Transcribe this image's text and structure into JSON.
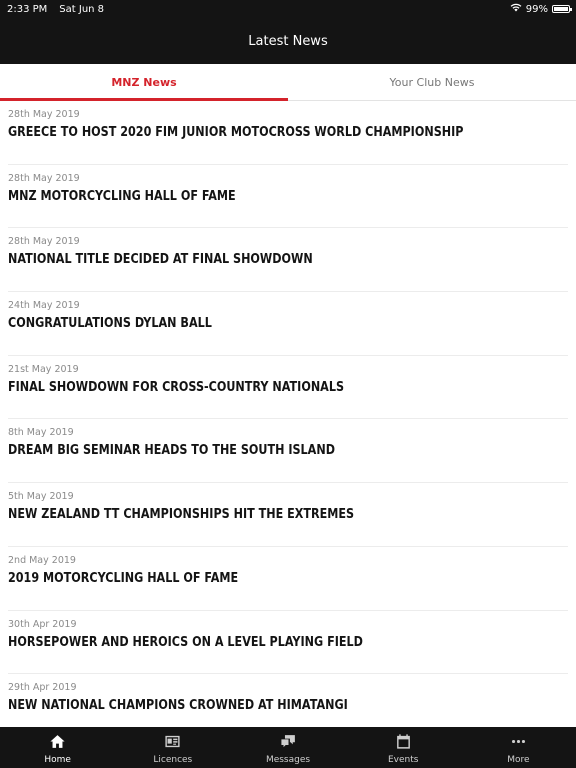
{
  "status_bar": {
    "time": "2:33 PM",
    "date": "Sat Jun 8",
    "battery": "99%",
    "battery_level": 0.99
  },
  "header": {
    "title": "Latest News"
  },
  "tabs": [
    {
      "label": "MNZ News",
      "active": true
    },
    {
      "label": "Your Club News",
      "active": false
    }
  ],
  "news": [
    {
      "date": "28th May 2019",
      "title": "GREECE TO HOST 2020 FIM JUNIOR MOTOCROSS WORLD CHAMPIONSHIP"
    },
    {
      "date": "28th May 2019",
      "title": "MNZ MOTORCYCLING HALL OF FAME"
    },
    {
      "date": "28th May 2019",
      "title": "NATIONAL TITLE DECIDED AT FINAL SHOWDOWN"
    },
    {
      "date": "24th May 2019",
      "title": "CONGRATULATIONS DYLAN BALL"
    },
    {
      "date": "21st May 2019",
      "title": "FINAL SHOWDOWN FOR CROSS-COUNTRY NATIONALS"
    },
    {
      "date": "8th May 2019",
      "title": "DREAM BIG SEMINAR HEADS TO THE SOUTH ISLAND"
    },
    {
      "date": "5th May 2019",
      "title": "NEW ZEALAND TT CHAMPIONSHIPS HIT THE EXTREMES"
    },
    {
      "date": "2nd May 2019",
      "title": "2019 MOTORCYCLING HALL OF FAME"
    },
    {
      "date": "30th Apr 2019",
      "title": "HORSEPOWER AND HEROICS ON A LEVEL PLAYING FIELD"
    },
    {
      "date": "29th Apr 2019",
      "title": "NEW NATIONAL CHAMPIONS CROWNED AT HIMATANGI"
    }
  ],
  "tabbar": [
    {
      "label": "Home",
      "icon": "home-icon",
      "active": true
    },
    {
      "label": "Licences",
      "icon": "licence-card-icon",
      "active": false
    },
    {
      "label": "Messages",
      "icon": "messages-icon",
      "active": false
    },
    {
      "label": "Events",
      "icon": "calendar-icon",
      "active": false
    },
    {
      "label": "More",
      "icon": "more-dots-icon",
      "active": false
    }
  ],
  "colors": {
    "accent": "#d4232b",
    "bar_background": "#141414"
  }
}
